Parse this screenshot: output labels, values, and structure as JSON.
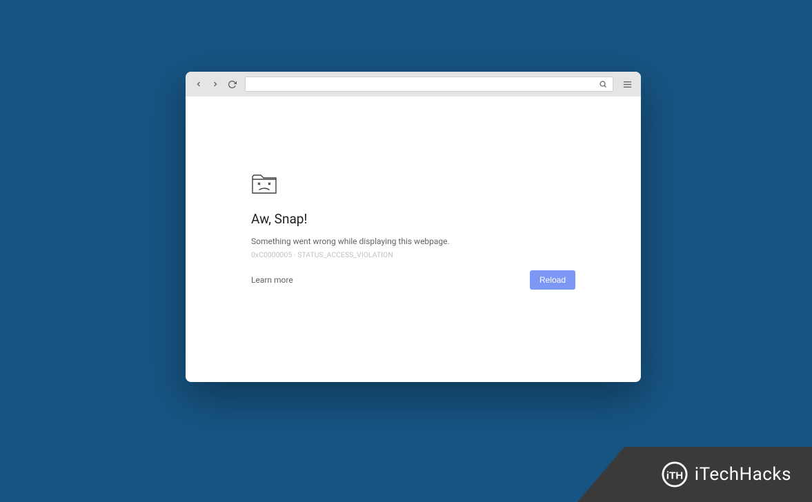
{
  "toolbar": {
    "address_value": ""
  },
  "error": {
    "title": "Aw, Snap!",
    "message": "Something went wrong while displaying this webpage.",
    "code": "0xC0000005 · STATUS_ACCESS_VIOLATION",
    "learn_more_label": "Learn more",
    "reload_label": "Reload"
  },
  "watermark": {
    "brand": "iTechHacks"
  }
}
